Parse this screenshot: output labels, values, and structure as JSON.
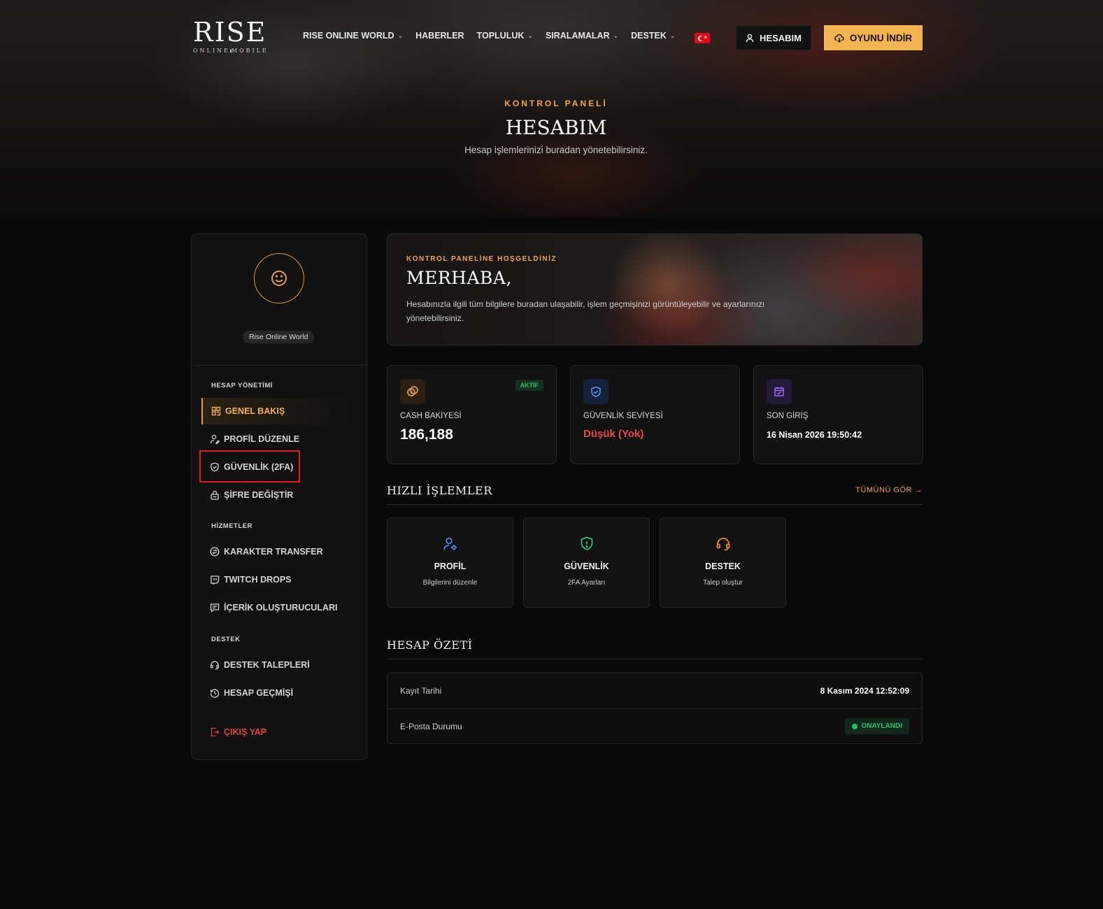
{
  "logo": {
    "main": "RISE",
    "sub_left": "ONLINE",
    "sub_right": "MOBILE"
  },
  "nav": {
    "items": [
      {
        "label": "RISE ONLINE WORLD",
        "has_dropdown": true
      },
      {
        "label": "HABERLER",
        "has_dropdown": false
      },
      {
        "label": "TOPLULUK",
        "has_dropdown": true
      },
      {
        "label": "SIRALAMALAR",
        "has_dropdown": true
      },
      {
        "label": "DESTEK",
        "has_dropdown": true
      }
    ],
    "language_flag": "flag-tr-icon",
    "account_label": "HESABIM",
    "download_label": "OYUNU İNDİR"
  },
  "hero": {
    "kicker": "KONTROL PANELİ",
    "title": "HESABIM",
    "subtitle": "Hesap işlemlerinizi buradan yönetebilirsiniz."
  },
  "sidebar": {
    "server_badge": "Rise Online World",
    "sections": [
      {
        "label": "HESAP YÖNETİMİ",
        "items": [
          {
            "label": "GENEL BAKIŞ",
            "icon": "grid-icon",
            "active": true
          },
          {
            "label": "PROFİL DÜZENLE",
            "icon": "user-edit-icon",
            "active": false
          },
          {
            "label": "GÜVENLİK (2FA)",
            "icon": "shield-check-icon",
            "active": false,
            "highlighted": true
          },
          {
            "label": "ŞİFRE DEĞİŞTİR",
            "icon": "lock-icon",
            "active": false
          }
        ]
      },
      {
        "label": "HİZMETLER",
        "items": [
          {
            "label": "KARAKTER TRANSFER",
            "icon": "transfer-icon"
          },
          {
            "label": "TWITCH DROPS",
            "icon": "twitch-icon"
          },
          {
            "label": "İÇERİK OLUŞTURUCULARI",
            "icon": "chat-icon"
          }
        ]
      },
      {
        "label": "DESTEK",
        "items": [
          {
            "label": "DESTEK TALEPLERİ",
            "icon": "headset-icon"
          },
          {
            "label": "HESAP GEÇMİŞİ",
            "icon": "history-icon"
          }
        ]
      }
    ],
    "logout_label": "ÇIKIŞ YAP"
  },
  "banner": {
    "kicker": "KONTROL PANELİNE HOŞGELDİNİZ",
    "title": "MERHABA,",
    "description": "Hesabınızla ilgili tüm bilgilere buradan ulaşabilir, işlem geçmişinizi görüntüleyebilir ve ayarlarınızı yönetebilirsiniz."
  },
  "stats": [
    {
      "label": "CASH BAKİYESİ",
      "value": "186,188",
      "badge": "AKTİF",
      "icon": "coins-icon",
      "value_color": "#ffffff"
    },
    {
      "label": "GÜVENLİK SEVİYESİ",
      "value": "Düşük (Yok)",
      "icon": "shield-icon",
      "value_color": "#e5484d"
    },
    {
      "label": "SON GİRİŞ",
      "value": "16 Nisan 2026 19:50:42",
      "icon": "calendar-check-icon",
      "value_color": "#ffffff"
    }
  ],
  "quick_actions": {
    "title": "HIZLI İŞLEMLER",
    "see_all": "TÜMÜNÜ GÖR →",
    "items": [
      {
        "title": "PROFİL",
        "subtitle": "Bilgilerini düzenle",
        "icon": "user-gear-icon",
        "color": "#4f8cf7"
      },
      {
        "title": "GÜVENLİK",
        "subtitle": "2FA Ayarları",
        "icon": "shield-alert-icon",
        "color": "#2fbf71"
      },
      {
        "title": "DESTEK",
        "subtitle": "Talep oluştur",
        "icon": "headset-icon",
        "color": "#f08a2c"
      }
    ]
  },
  "summary": {
    "title": "HESAP ÖZETİ",
    "rows": [
      {
        "key": "Kayıt Tarihi",
        "value": "8 Kasım 2024 12:52:09"
      },
      {
        "key": "E-Posta Durumu",
        "status": "ONAYLANDI"
      }
    ]
  },
  "colors": {
    "accent": "#f4b451",
    "accent_text": "#f0a64a",
    "danger": "#e5484d",
    "success": "#22c26a",
    "highlight": "#e11d1d"
  }
}
